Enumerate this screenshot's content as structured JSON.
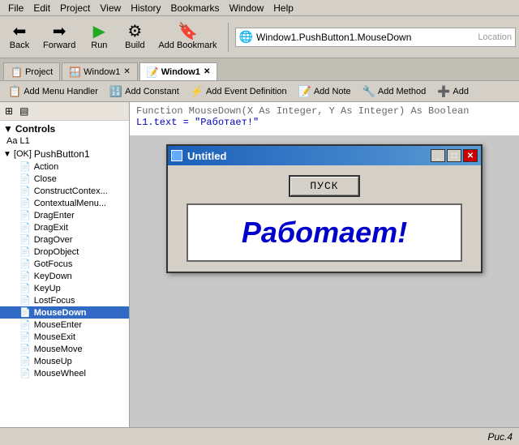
{
  "menu": {
    "items": [
      "File",
      "Edit",
      "Project",
      "View",
      "History",
      "Bookmarks",
      "Window",
      "Help"
    ]
  },
  "toolbar": {
    "back_label": "Back",
    "forward_label": "Forward",
    "run_label": "Run",
    "build_label": "Build",
    "add_bookmark_label": "Add Bookmark",
    "location_text": "Window1.PushButton1.MouseDown",
    "location_placeholder": "Location"
  },
  "tabs": [
    {
      "label": "Project",
      "active": false,
      "closable": false
    },
    {
      "label": "Window1",
      "active": false,
      "closable": true
    },
    {
      "label": "Window1",
      "active": true,
      "closable": true
    }
  ],
  "action_bar": {
    "buttons": [
      "Add Menu Handler",
      "Add Constant",
      "Add Event Definition",
      "Add Note",
      "Add Method",
      "Add"
    ]
  },
  "left_panel": {
    "header": "Controls",
    "sub_header": "Aa L1",
    "group": "PushButton1",
    "items": [
      "Action",
      "Close",
      "ConstructContex...",
      "ContextualMenu...",
      "DragEnter",
      "DragExit",
      "DragOver",
      "DropObject",
      "GotFocus",
      "KeyDown",
      "KeyUp",
      "LostFocus",
      "MouseDown",
      "MouseEnter",
      "MouseExit",
      "MouseMove",
      "MouseUp",
      "MouseWheel"
    ],
    "selected_item": "MouseDown"
  },
  "code_editor": {
    "line1": "Function MouseDown(X As Integer, Y As Integer) As Boolean",
    "line2": "  L1.text = \"Работает!\""
  },
  "sim_window": {
    "title": "Untitled",
    "button_label": "ПУСК",
    "label_text": "Работает!"
  },
  "status_bar": {
    "caption": "Рис.4"
  }
}
